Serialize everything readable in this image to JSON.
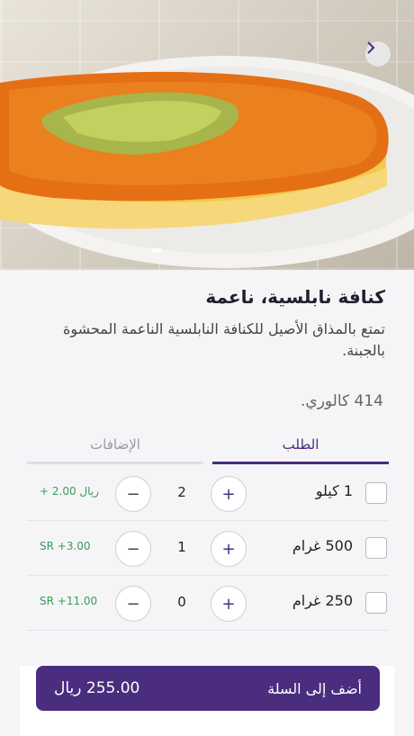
{
  "hero": {
    "image_name": "kunafa-photo",
    "next_icon": "chevron-right-icon"
  },
  "product": {
    "title": "كنافة نابلسية، ناعمة",
    "description": "تمتع بالمذاق الأصيل للكنافة النابلسية الناعمة المحشوة بالجبنة.",
    "calories": "414 كالوري."
  },
  "tabs": {
    "order": "الطلب",
    "extras": "الإضافات"
  },
  "options": [
    {
      "label": "1 كيلو",
      "qty": "2",
      "price": "+ 2.00 ريال"
    },
    {
      "label": "500 غرام",
      "qty": "1",
      "price": "SR +3.00"
    },
    {
      "label": "250 غرام",
      "qty": "0",
      "price": "SR +11.00"
    }
  ],
  "controls": {
    "plus": "+",
    "minus": "−"
  },
  "cart": {
    "label": "أضف إلى السلة",
    "total": "255.00 ريال"
  },
  "colors": {
    "brand": "#4a2d7f",
    "price": "#3a9a5b"
  }
}
